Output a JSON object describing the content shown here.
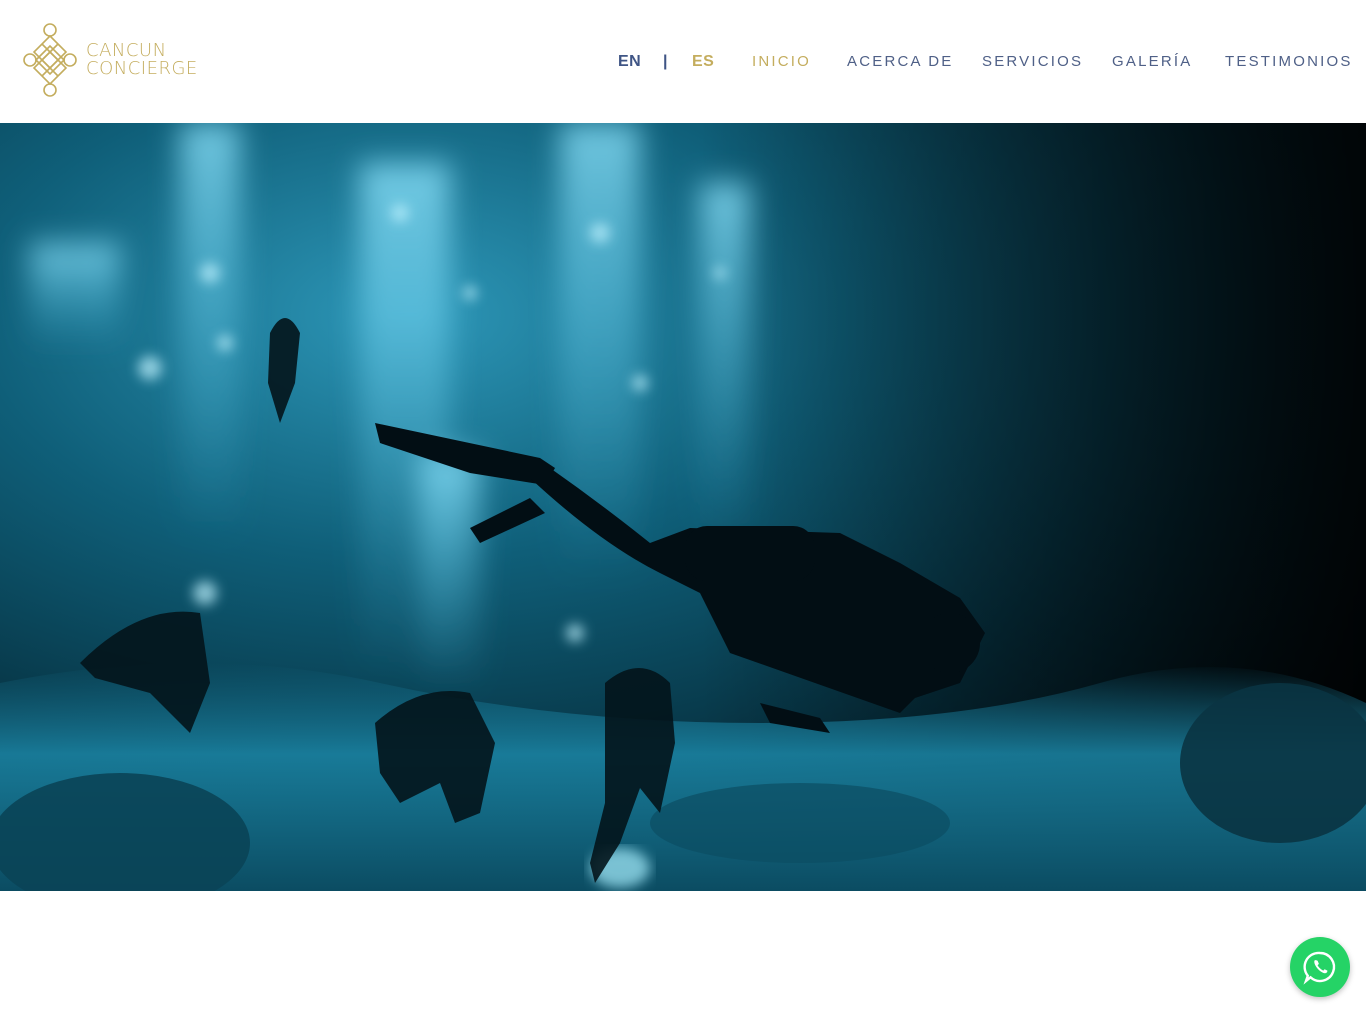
{
  "brand": {
    "line1": "CANCUN",
    "line2": "CONCIERGE",
    "gold": "#c4ad5e",
    "navy": "#4f6087"
  },
  "language": {
    "en": "EN",
    "separator": "|",
    "es": "ES",
    "active": "ES"
  },
  "nav": {
    "items": [
      {
        "label": "INICIO",
        "active": true
      },
      {
        "label": "ACERCA DE",
        "active": false
      },
      {
        "label": "SERVICIOS",
        "active": false
      },
      {
        "label": "GALERÍA",
        "active": false
      },
      {
        "label": "TESTIMONIOS",
        "active": false
      }
    ]
  },
  "hero": {
    "media": "underwater-cenote-divers-video",
    "colors": {
      "light": "#36a9c9",
      "mid": "#0d5a73",
      "dark": "#031820"
    }
  },
  "floating": {
    "icon": "whatsapp-icon",
    "color": "#25d366"
  }
}
